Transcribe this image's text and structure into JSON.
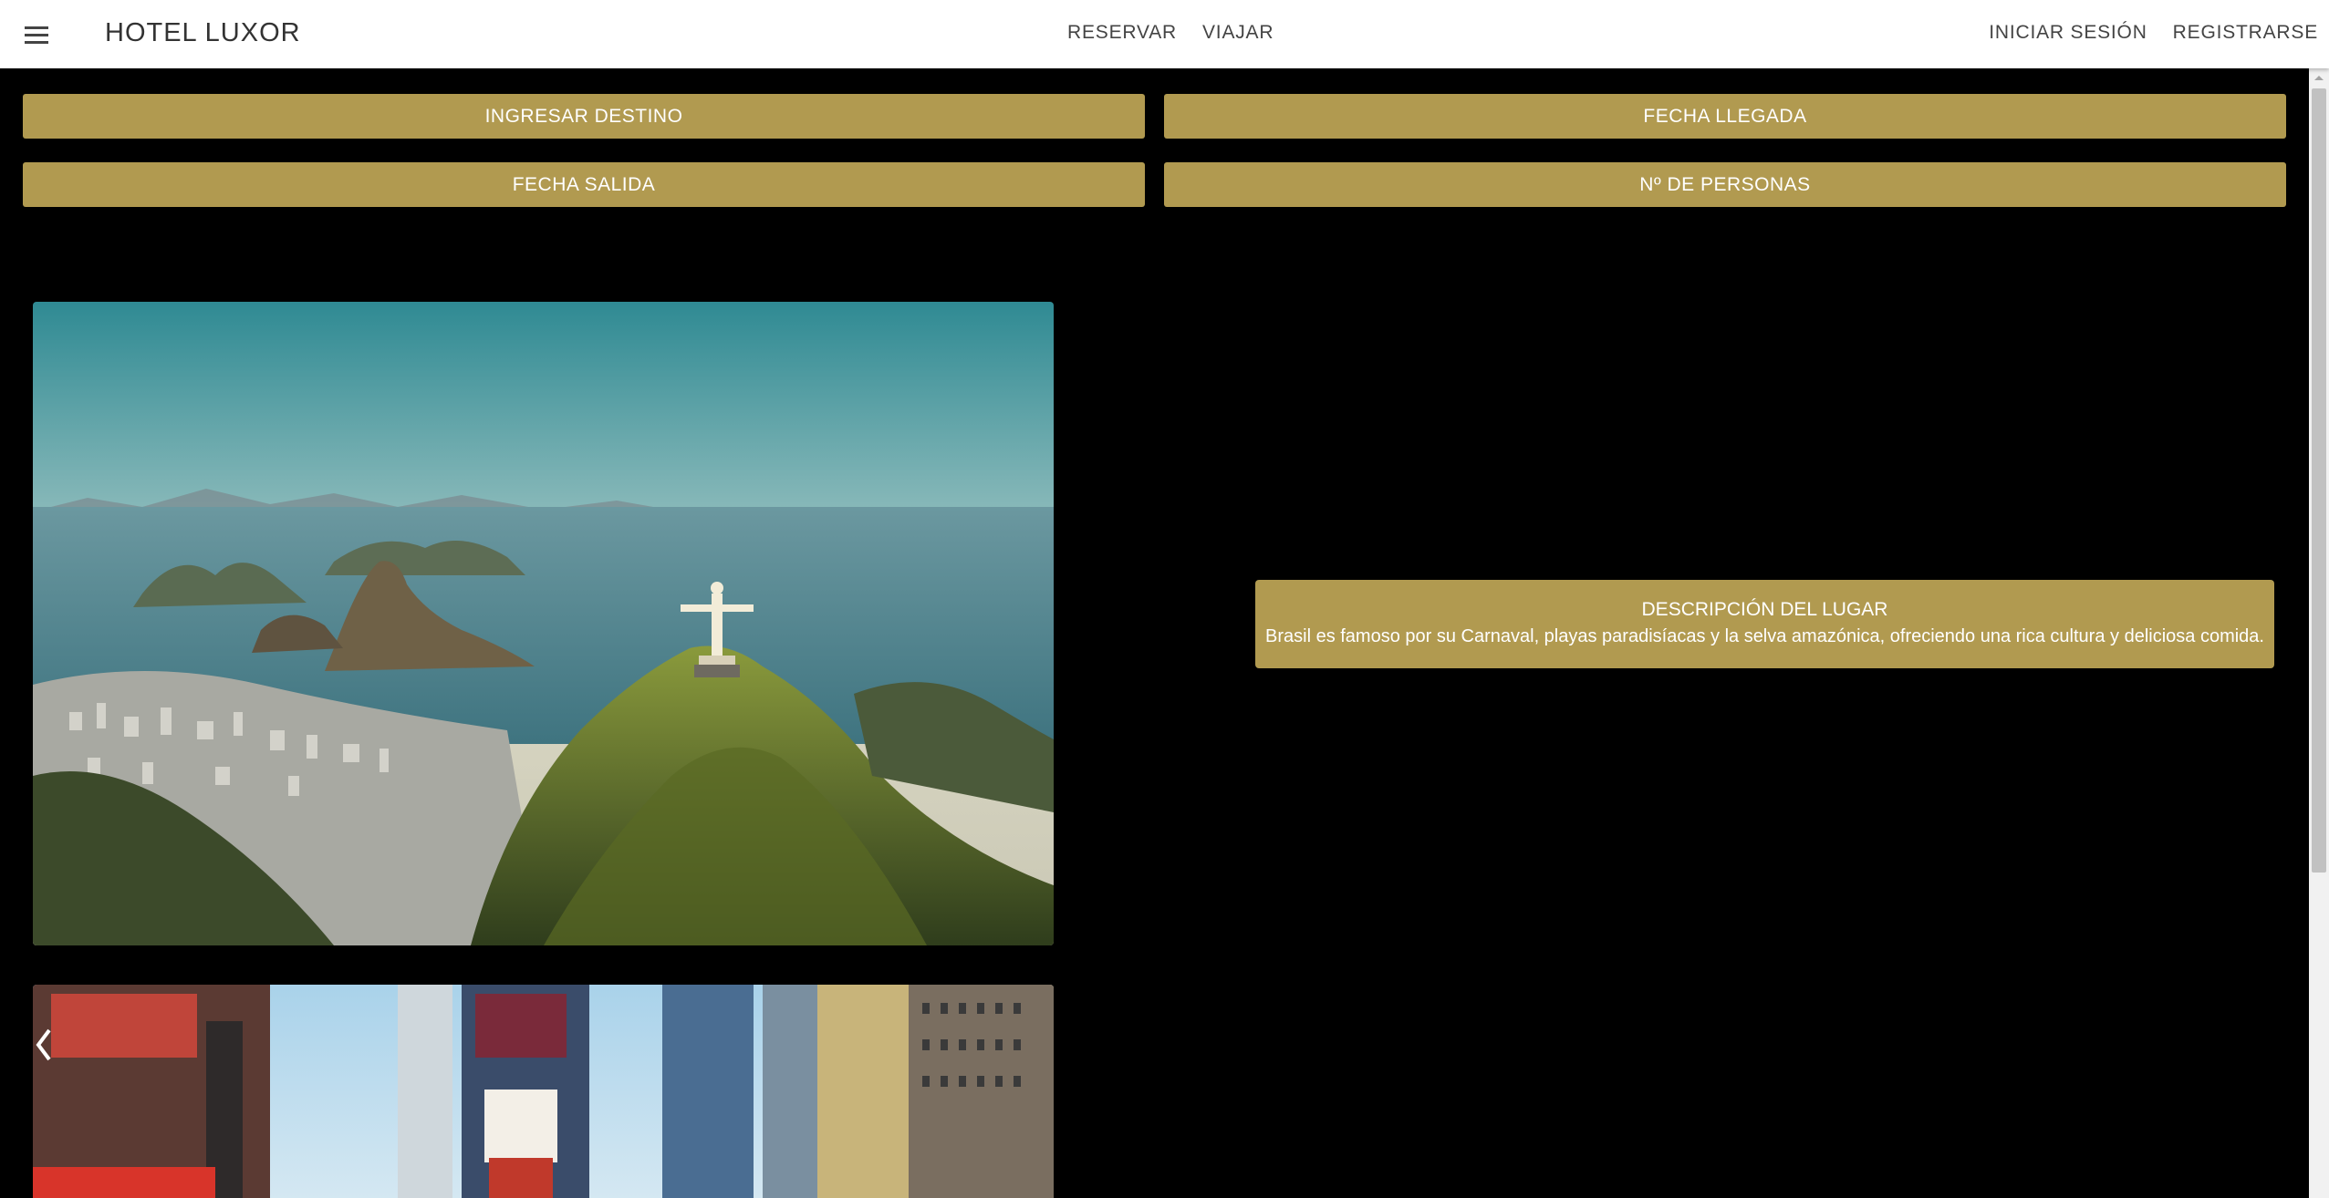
{
  "app": {
    "brand": "HOTEL LUXOR"
  },
  "nav": {
    "center": [
      {
        "label": "RESERVAR"
      },
      {
        "label": "VIAJAR"
      }
    ],
    "right": [
      {
        "label": "INICIAR SESIÓN"
      },
      {
        "label": "REGISTRARSE"
      }
    ]
  },
  "booking": {
    "destination_label": "INGRESAR DESTINO",
    "arrival_label": "FECHA LLEGADA",
    "departure_label": "FECHA SALIDA",
    "guests_label": "Nº DE PERSONAS"
  },
  "description": {
    "title": "DESCRIPCIÓN DEL LUGAR",
    "text": "Brasil es famoso por su Carnaval, playas paradisíacas y la selva amazónica, ofreciendo una rica cultura y deliciosa comida."
  },
  "icons": {
    "menu": "menu-icon",
    "scroll_up": "chevron-up-icon",
    "carousel_prev": "chevron-left-icon"
  },
  "colors": {
    "accent_gold": "#b19a50",
    "background": "#000000",
    "appbar": "#ffffff"
  }
}
